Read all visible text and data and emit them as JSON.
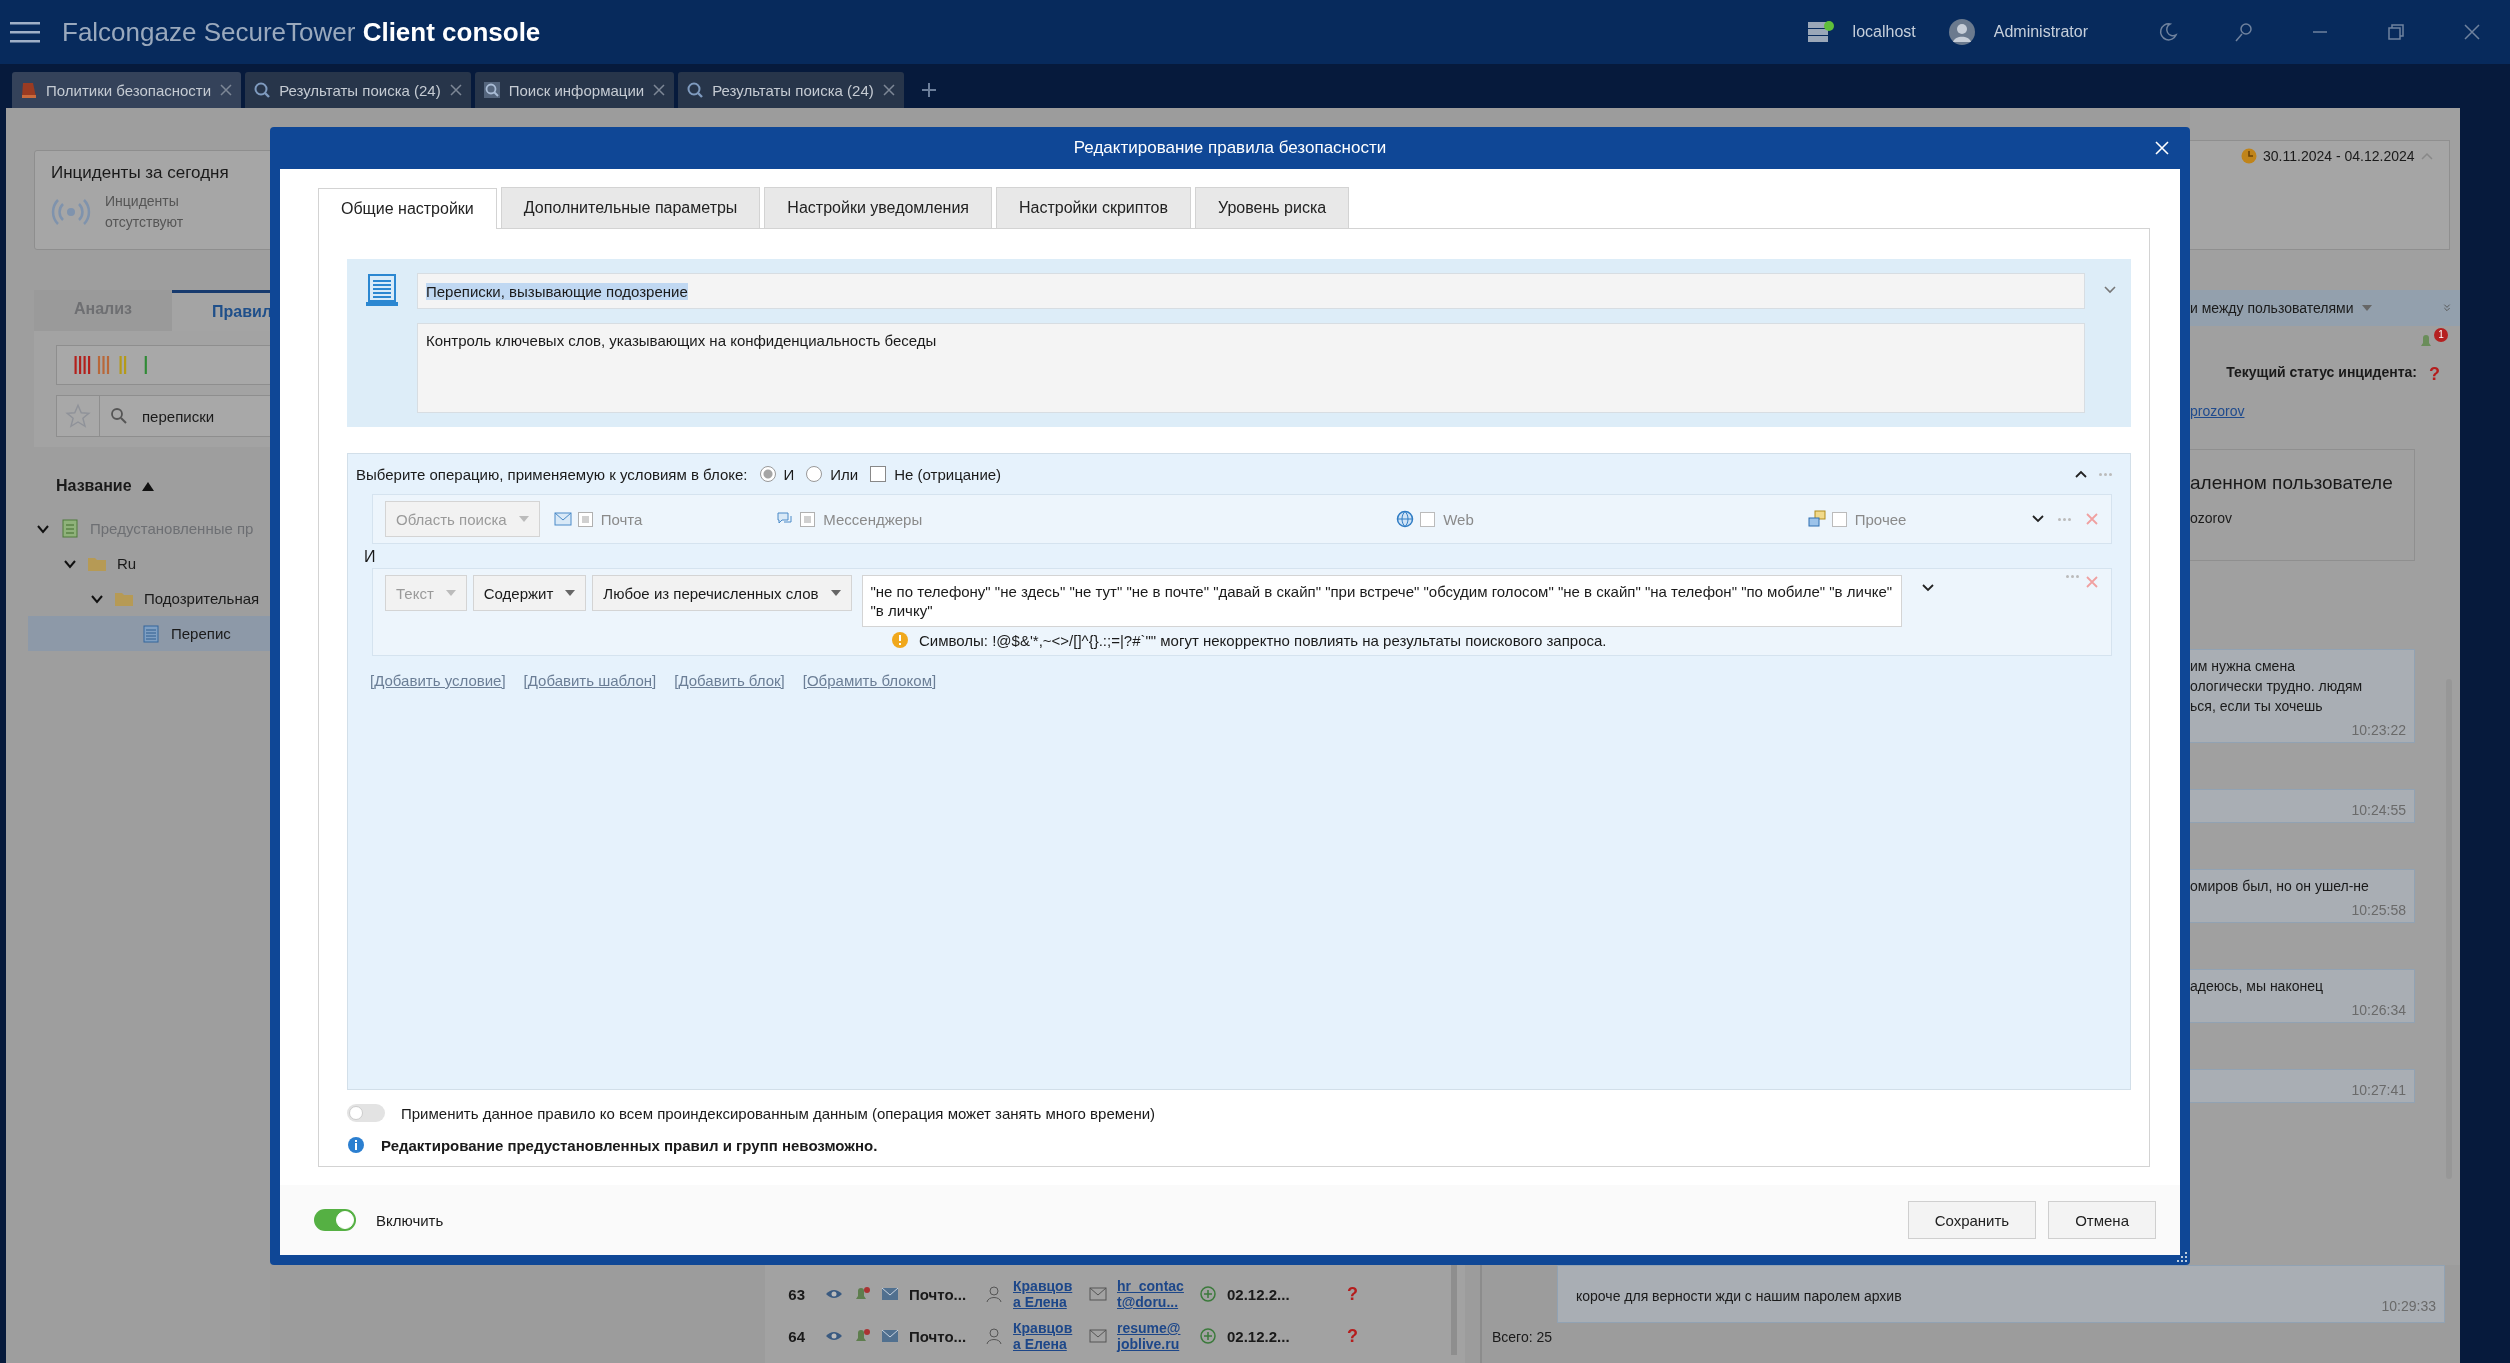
{
  "app": {
    "title_light": "Falcongaze SecureTower",
    "title_bold": "Client console",
    "server": "localhost",
    "user": "Administrator"
  },
  "tabs": [
    {
      "label": "Политики безопасности",
      "selected": true,
      "kind": "policy"
    },
    {
      "label": "Результаты поиска (24)",
      "selected": false,
      "kind": "search"
    },
    {
      "label": "Поиск информации",
      "selected": false,
      "kind": "find"
    },
    {
      "label": "Результаты поиска (24)",
      "selected": false,
      "kind": "search"
    }
  ],
  "left_panel": {
    "incidents_title": "Инциденты за сегодня",
    "incidents_status": "Инциденты отсутствуют",
    "tabs": [
      {
        "label": "Анализ",
        "selected": false
      },
      {
        "label": "Правил",
        "selected": true
      }
    ],
    "search": {
      "value": "переписки"
    },
    "column": "Название",
    "tree": [
      {
        "label": "Предустановленные пр",
        "kind": "group",
        "expanded": true,
        "selected": false,
        "children": [
          {
            "label": "Ru",
            "kind": "folder",
            "expanded": true,
            "selected": false,
            "children": [
              {
                "label": "Подозрительная",
                "kind": "folder",
                "expanded": true,
                "selected": false,
                "children": [
                  {
                    "label": "Перепис",
                    "kind": "rule",
                    "selected": true
                  }
                ]
              }
            ]
          }
        ]
      }
    ]
  },
  "table_rows": [
    {
      "number": "63",
      "type": "Почто...",
      "user": [
        "Кравцов",
        "а Елена"
      ],
      "contact": [
        "hr_contac",
        "t@doru..."
      ],
      "date": "02.12.2...",
      "status": "?"
    },
    {
      "number": "64",
      "type": "Почто...",
      "user": [
        "Кравцов",
        "а Елена"
      ],
      "contact": [
        "resume@",
        "joblive.ru"
      ],
      "date": "02.12.2...",
      "status": "?"
    }
  ],
  "right_panel": {
    "date_range": "30.11.2024 - 04.12.2024",
    "filter": "и между пользователями",
    "alert_count": "1",
    "status_label": "Текущий статус инцидента:",
    "status_value": "?",
    "user_link": "prozorov",
    "user_card_title": "аленном пользователе",
    "user_card_login": "ozorov",
    "messages": [
      {
        "lines": [
          "им нужна смена",
          "ологически трудно. людям",
          "ься, если ты хочешь"
        ],
        "time": "10:23:22"
      },
      {
        "time": "10:24:55"
      },
      {
        "lines": [
          "омиров был, но он ушел-не"
        ],
        "time": "10:25:58"
      },
      {
        "lines": [
          "адеюсь, мы наконец"
        ],
        "time": "10:26:34"
      },
      {
        "time": "10:27:41"
      },
      {
        "lines": [
          "короче для верности жди с нашим паролем архив"
        ],
        "time": "10:29:33"
      }
    ],
    "total": "Всего: 25"
  },
  "dialog": {
    "title": "Редактирование правила безопасности",
    "tabs": [
      {
        "label": "Общие настройки",
        "selected": true
      },
      {
        "label": "Дополнительные параметры",
        "selected": false
      },
      {
        "label": "Настройки уведомления",
        "selected": false
      },
      {
        "label": "Настройки скриптов",
        "selected": false
      },
      {
        "label": "Уровень риска",
        "selected": false
      }
    ],
    "rule_name": "Переписки, вызывающие подозрение",
    "rule_description": "Контроль ключевых слов, указывающих на конфиденциальность беседы",
    "operation_label": "Выберите операцию, применяемую к условиям в блоке:",
    "operations": [
      {
        "label": "И",
        "selected": true
      },
      {
        "label": "Или",
        "selected": false
      }
    ],
    "negation": {
      "label": "Не (отрицание)",
      "checked": false
    },
    "scope": {
      "placeholder": "Область поиска",
      "channels": [
        {
          "label": "Почта",
          "checked": true,
          "kind": "mail"
        },
        {
          "label": "Мессенджеры",
          "checked": true,
          "kind": "messenger"
        },
        {
          "label": "Web",
          "checked": false,
          "kind": "web"
        },
        {
          "label": "Прочее",
          "checked": false,
          "kind": "other"
        }
      ]
    },
    "joiner": "И",
    "condition": {
      "field": "Текст",
      "operator": "Содержит",
      "mode": "Любое из перечисленных слов",
      "value": "\"не по телефону\" \"не здесь\" \"не тут\" \"не в почте\" \"давай в скайп\" \"при встрече\" \"обсудим голосом\" \"не в скайп\" \"на телефон\" \"по мобиле\" \"в личке\" \"в личку\"",
      "warning": "Символы: !@$&'*,~<>/[]^{}.:;=|?#`\"\" могут некорректно повлиять на результаты поискового запроса."
    },
    "links": [
      "[Добавить условие]",
      "[Добавить шаблон]",
      "[Добавить блок]",
      "[Обрамить блоком]"
    ],
    "apply_all": {
      "label": "Применить данное правило ко всем проиндексированным данным (операция может занять много времени)",
      "on": false
    },
    "info": "Редактирование предустановленных правил и групп невозможно.",
    "enable": {
      "label": "Включить",
      "on": true
    },
    "buttons": [
      "Сохранить",
      "Отмена"
    ]
  }
}
